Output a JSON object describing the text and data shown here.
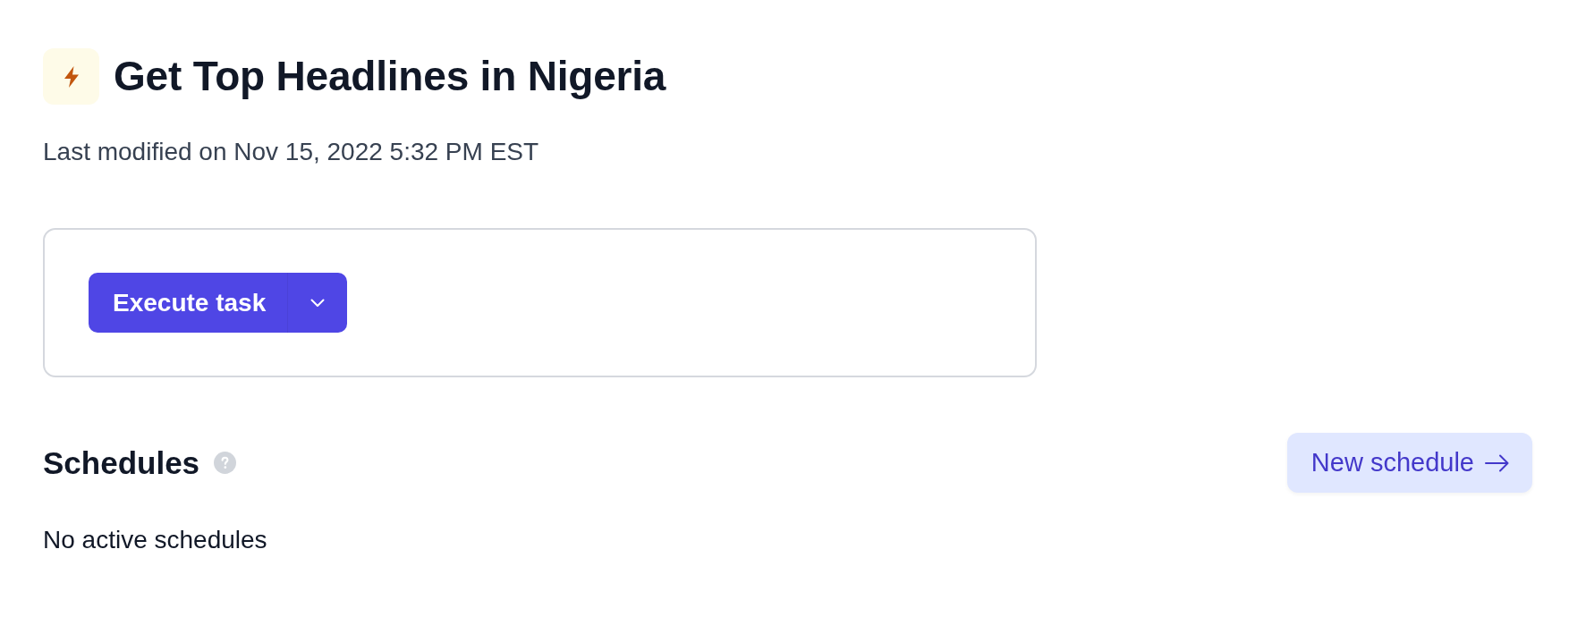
{
  "header": {
    "title": "Get Top Headlines in Nigeria",
    "subtitle": "Last modified on Nov 15, 2022 5:32 PM EST"
  },
  "task_card": {
    "primary_button": "Execute task"
  },
  "schedules": {
    "heading": "Schedules",
    "action_button": "New schedule",
    "empty_message": "No active schedules"
  }
}
